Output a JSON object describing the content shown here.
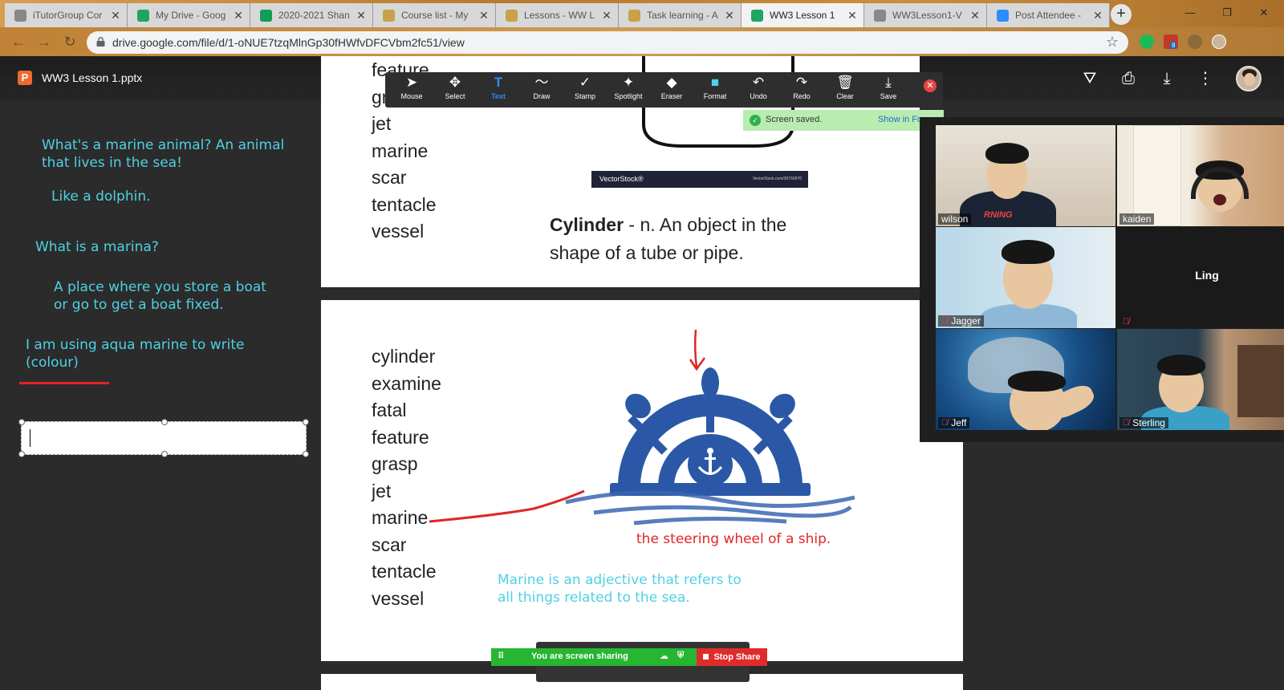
{
  "browser": {
    "tabs": [
      {
        "title": "iTutorGroup Cor",
        "icon": "globe-icon",
        "color": "#888888"
      },
      {
        "title": "My Drive - Goog",
        "icon": "google-drive-icon",
        "color": "#1fa463"
      },
      {
        "title": "2020-2021 Shan",
        "icon": "google-sheets-icon",
        "color": "#0f9d58"
      },
      {
        "title": "Course list - My",
        "icon": "bookmark-icon",
        "color": "#c8a24a"
      },
      {
        "title": "Lessons - WW L",
        "icon": "bookmark-icon",
        "color": "#c8a24a"
      },
      {
        "title": "Task learning - A",
        "icon": "bookmark-icon",
        "color": "#c8a24a"
      },
      {
        "title": "WW3 Lesson 1",
        "icon": "google-drive-icon",
        "color": "#1fa463"
      },
      {
        "title": "WW3Lesson1-V",
        "icon": "globe-icon",
        "color": "#888888"
      },
      {
        "title": "Post Attendee -",
        "icon": "zoom-icon",
        "color": "#2d8cff"
      }
    ],
    "active_tab": 6,
    "new_tab": "+",
    "url": "drive.google.com/file/d/1-oNUE7tzqMlnGp30fHWfvDFCVbm2fc51/view",
    "extension_badge": "8"
  },
  "viewer": {
    "file_name": "WW3 Lesson 1.pptx",
    "file_type_letter": "P"
  },
  "notes": [
    {
      "text": "What's a marine animal?  An animal\nthat lives in the sea!"
    },
    {
      "text": "Like a dolphin."
    },
    {
      "text": "What is a marina?"
    },
    {
      "text": "A place where you store a boat\nor go to get a boat fixed."
    },
    {
      "text": "I am using aqua marine to write\n(colour)"
    }
  ],
  "annotation_colors": {
    "aqua": "#4fd1e4",
    "red": "#e02626"
  },
  "slide1": {
    "vocab": [
      "feature",
      "grasp",
      "jet",
      "marine",
      "scar",
      "tentacle",
      "vessel"
    ],
    "banner_left": "VectorStock®",
    "banner_right": "VectorStock.com/30760970",
    "definition_term": "Cylinder",
    "definition_rest": " - n. An object in the",
    "definition_line2": "shape  of a tube or pipe."
  },
  "slide2": {
    "vocab": [
      "cylinder",
      "examine",
      "fatal",
      "feature",
      "grasp",
      "jet",
      "marine",
      "scar",
      "tentacle",
      "vessel"
    ],
    "steering_caption": "the steering wheel of a ship.",
    "marine_definition": "Marine is an adjective that refers to\nall things related to the sea."
  },
  "annotate_toolbar": {
    "tools": [
      {
        "label": "Mouse",
        "icon": "cursor-icon",
        "glyph": "➤"
      },
      {
        "label": "Select",
        "icon": "move-icon",
        "glyph": "✥"
      },
      {
        "label": "Text",
        "icon": "text-icon",
        "glyph": "T"
      },
      {
        "label": "Draw",
        "icon": "squiggle-icon",
        "glyph": "〜"
      },
      {
        "label": "Stamp",
        "icon": "checkmark-icon",
        "glyph": "✓"
      },
      {
        "label": "Spotlight",
        "icon": "wand-icon",
        "glyph": "✦"
      },
      {
        "label": "Eraser",
        "icon": "eraser-icon",
        "glyph": "◆"
      },
      {
        "label": "Format",
        "icon": "format-swatch-icon",
        "glyph": "■"
      },
      {
        "label": "Undo",
        "icon": "undo-icon",
        "glyph": "↶"
      },
      {
        "label": "Redo",
        "icon": "redo-icon",
        "glyph": "↷"
      },
      {
        "label": "Clear",
        "icon": "trash-icon",
        "glyph": "🗑"
      },
      {
        "label": "Save",
        "icon": "save-icon",
        "glyph": "⤓"
      }
    ],
    "selected": "Text",
    "saved_message": "Screen saved.",
    "show_in_folder": "Show in Fo"
  },
  "participants": [
    {
      "name": "wilson",
      "muted": false,
      "video": true,
      "active": false
    },
    {
      "name": "kaiden",
      "muted": false,
      "video": true,
      "active": true
    },
    {
      "name": "Jagger",
      "muted": true,
      "video": true,
      "active": false
    },
    {
      "name": "Ling",
      "muted": true,
      "video": false,
      "active": false
    },
    {
      "name": "Jeff",
      "muted": true,
      "video": true,
      "active": false
    },
    {
      "name": "Sterling",
      "muted": true,
      "video": true,
      "active": false
    }
  ],
  "screen_share": {
    "status": "You are screen sharing",
    "stop_label": "Stop Share"
  }
}
